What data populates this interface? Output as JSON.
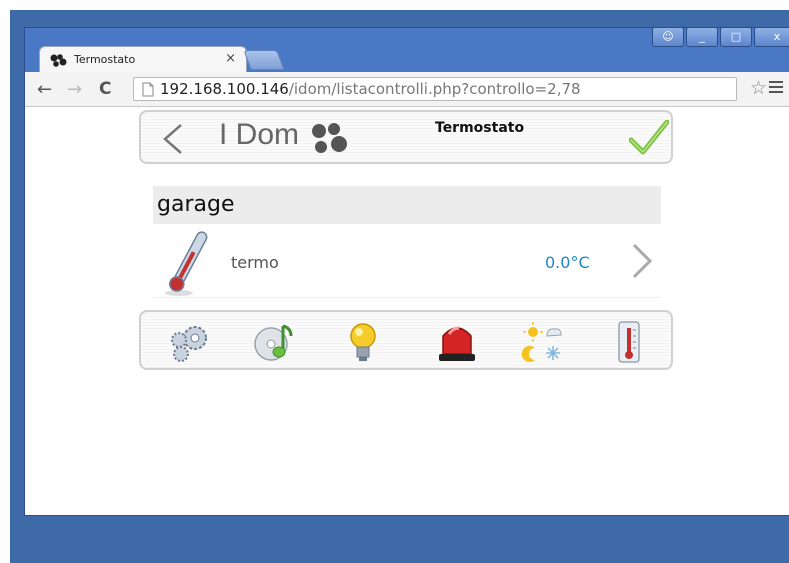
{
  "browser": {
    "tab_title": "Termostato",
    "tab_close": "×",
    "url_host": "192.168.100.146",
    "url_path": "/idom/listacontrolli.php?controllo=2,78",
    "window_controls": [
      "☺",
      "_",
      "□",
      "x"
    ]
  },
  "app": {
    "logo_text": "I Dom",
    "header_title": "Termostato"
  },
  "room": {
    "name": "garage",
    "devices": [
      {
        "label": "termo",
        "value": "0.0°C"
      }
    ]
  },
  "categories": [
    {
      "name": "settings",
      "icon": "gears-icon"
    },
    {
      "name": "multimedia",
      "icon": "music-disc-icon"
    },
    {
      "name": "lights",
      "icon": "light-bulb-icon"
    },
    {
      "name": "alarm",
      "icon": "alarm-siren-icon"
    },
    {
      "name": "weather",
      "icon": "weather-icon"
    },
    {
      "name": "thermostat",
      "icon": "thermometer-icon"
    }
  ],
  "colors": {
    "accent_value": "#1f86c6",
    "check_green": "#7cc242"
  }
}
